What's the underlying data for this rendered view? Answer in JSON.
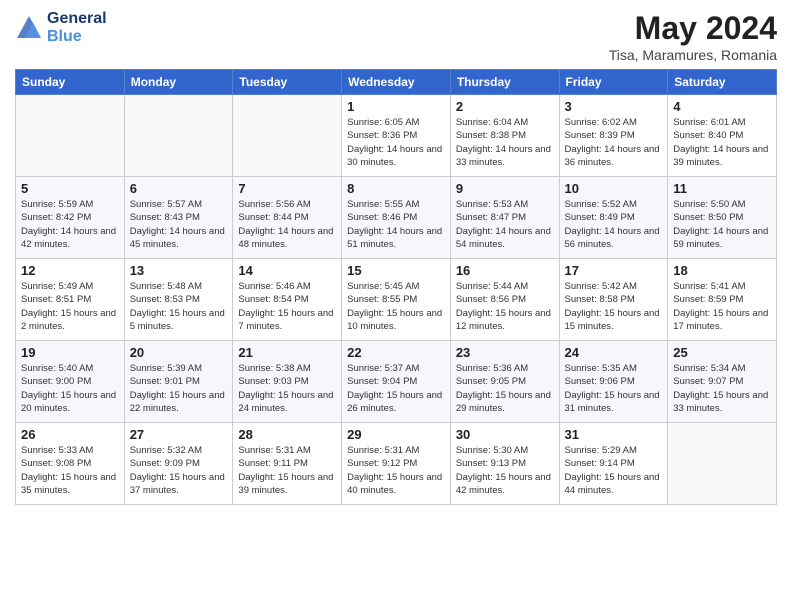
{
  "header": {
    "logo_line1": "General",
    "logo_line2": "Blue",
    "month": "May 2024",
    "location": "Tisa, Maramures, Romania"
  },
  "weekdays": [
    "Sunday",
    "Monday",
    "Tuesday",
    "Wednesday",
    "Thursday",
    "Friday",
    "Saturday"
  ],
  "weeks": [
    [
      {
        "day": "",
        "info": ""
      },
      {
        "day": "",
        "info": ""
      },
      {
        "day": "",
        "info": ""
      },
      {
        "day": "1",
        "info": "Sunrise: 6:05 AM\nSunset: 8:36 PM\nDaylight: 14 hours\nand 30 minutes."
      },
      {
        "day": "2",
        "info": "Sunrise: 6:04 AM\nSunset: 8:38 PM\nDaylight: 14 hours\nand 33 minutes."
      },
      {
        "day": "3",
        "info": "Sunrise: 6:02 AM\nSunset: 8:39 PM\nDaylight: 14 hours\nand 36 minutes."
      },
      {
        "day": "4",
        "info": "Sunrise: 6:01 AM\nSunset: 8:40 PM\nDaylight: 14 hours\nand 39 minutes."
      }
    ],
    [
      {
        "day": "5",
        "info": "Sunrise: 5:59 AM\nSunset: 8:42 PM\nDaylight: 14 hours\nand 42 minutes."
      },
      {
        "day": "6",
        "info": "Sunrise: 5:57 AM\nSunset: 8:43 PM\nDaylight: 14 hours\nand 45 minutes."
      },
      {
        "day": "7",
        "info": "Sunrise: 5:56 AM\nSunset: 8:44 PM\nDaylight: 14 hours\nand 48 minutes."
      },
      {
        "day": "8",
        "info": "Sunrise: 5:55 AM\nSunset: 8:46 PM\nDaylight: 14 hours\nand 51 minutes."
      },
      {
        "day": "9",
        "info": "Sunrise: 5:53 AM\nSunset: 8:47 PM\nDaylight: 14 hours\nand 54 minutes."
      },
      {
        "day": "10",
        "info": "Sunrise: 5:52 AM\nSunset: 8:49 PM\nDaylight: 14 hours\nand 56 minutes."
      },
      {
        "day": "11",
        "info": "Sunrise: 5:50 AM\nSunset: 8:50 PM\nDaylight: 14 hours\nand 59 minutes."
      }
    ],
    [
      {
        "day": "12",
        "info": "Sunrise: 5:49 AM\nSunset: 8:51 PM\nDaylight: 15 hours\nand 2 minutes."
      },
      {
        "day": "13",
        "info": "Sunrise: 5:48 AM\nSunset: 8:53 PM\nDaylight: 15 hours\nand 5 minutes."
      },
      {
        "day": "14",
        "info": "Sunrise: 5:46 AM\nSunset: 8:54 PM\nDaylight: 15 hours\nand 7 minutes."
      },
      {
        "day": "15",
        "info": "Sunrise: 5:45 AM\nSunset: 8:55 PM\nDaylight: 15 hours\nand 10 minutes."
      },
      {
        "day": "16",
        "info": "Sunrise: 5:44 AM\nSunset: 8:56 PM\nDaylight: 15 hours\nand 12 minutes."
      },
      {
        "day": "17",
        "info": "Sunrise: 5:42 AM\nSunset: 8:58 PM\nDaylight: 15 hours\nand 15 minutes."
      },
      {
        "day": "18",
        "info": "Sunrise: 5:41 AM\nSunset: 8:59 PM\nDaylight: 15 hours\nand 17 minutes."
      }
    ],
    [
      {
        "day": "19",
        "info": "Sunrise: 5:40 AM\nSunset: 9:00 PM\nDaylight: 15 hours\nand 20 minutes."
      },
      {
        "day": "20",
        "info": "Sunrise: 5:39 AM\nSunset: 9:01 PM\nDaylight: 15 hours\nand 22 minutes."
      },
      {
        "day": "21",
        "info": "Sunrise: 5:38 AM\nSunset: 9:03 PM\nDaylight: 15 hours\nand 24 minutes."
      },
      {
        "day": "22",
        "info": "Sunrise: 5:37 AM\nSunset: 9:04 PM\nDaylight: 15 hours\nand 26 minutes."
      },
      {
        "day": "23",
        "info": "Sunrise: 5:36 AM\nSunset: 9:05 PM\nDaylight: 15 hours\nand 29 minutes."
      },
      {
        "day": "24",
        "info": "Sunrise: 5:35 AM\nSunset: 9:06 PM\nDaylight: 15 hours\nand 31 minutes."
      },
      {
        "day": "25",
        "info": "Sunrise: 5:34 AM\nSunset: 9:07 PM\nDaylight: 15 hours\nand 33 minutes."
      }
    ],
    [
      {
        "day": "26",
        "info": "Sunrise: 5:33 AM\nSunset: 9:08 PM\nDaylight: 15 hours\nand 35 minutes."
      },
      {
        "day": "27",
        "info": "Sunrise: 5:32 AM\nSunset: 9:09 PM\nDaylight: 15 hours\nand 37 minutes."
      },
      {
        "day": "28",
        "info": "Sunrise: 5:31 AM\nSunset: 9:11 PM\nDaylight: 15 hours\nand 39 minutes."
      },
      {
        "day": "29",
        "info": "Sunrise: 5:31 AM\nSunset: 9:12 PM\nDaylight: 15 hours\nand 40 minutes."
      },
      {
        "day": "30",
        "info": "Sunrise: 5:30 AM\nSunset: 9:13 PM\nDaylight: 15 hours\nand 42 minutes."
      },
      {
        "day": "31",
        "info": "Sunrise: 5:29 AM\nSunset: 9:14 PM\nDaylight: 15 hours\nand 44 minutes."
      },
      {
        "day": "",
        "info": ""
      }
    ]
  ]
}
